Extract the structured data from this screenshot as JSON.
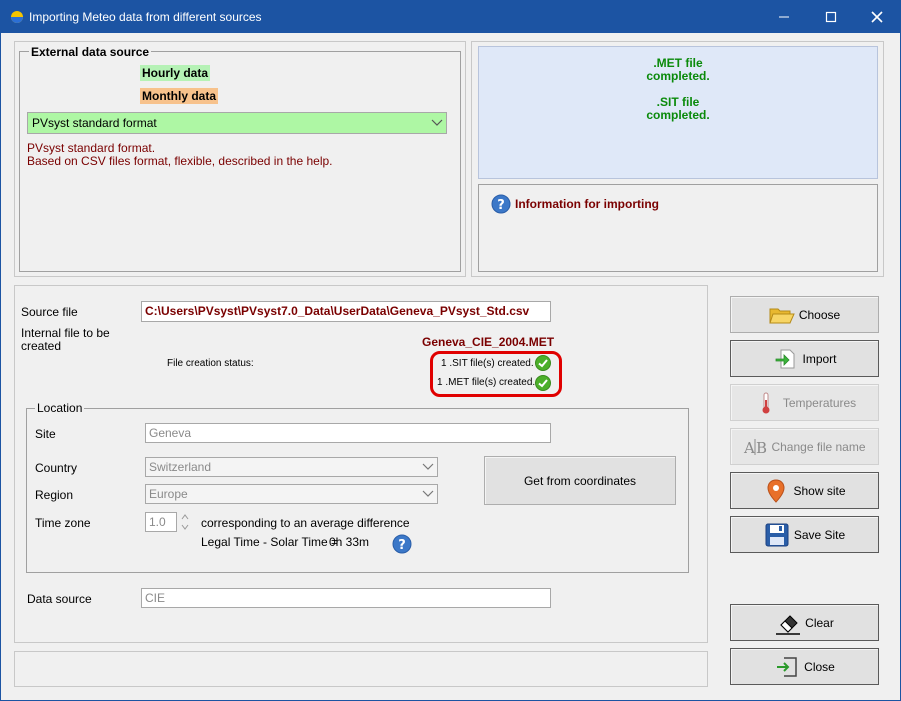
{
  "window": {
    "title": "Importing Meteo data from different sources"
  },
  "external_source": {
    "legend": "External data source",
    "hourly_label": "Hourly data",
    "monthly_label": "Monthly data",
    "format_selected": "PVsyst standard format",
    "description_line1": "PVsyst standard format.",
    "description_line2": "Based on CSV files format, flexible, described in the help."
  },
  "status_panel": {
    "met_line1": ".MET file",
    "met_line2": "completed.",
    "sit_line1": ".SIT file",
    "sit_line2": "completed."
  },
  "info_panel": {
    "title": "Information for importing"
  },
  "files": {
    "source_label": "Source file",
    "source_path": "C:\\Users\\PVsyst\\PVsyst7.0_Data\\UserData\\Geneva_PVsyst_Std.csv",
    "internal_label_1": "Internal file to be",
    "internal_label_2": "created",
    "internal_name": "Geneva_CIE_2004.MET",
    "status_label": "File creation status:",
    "sit_status": "1 .SIT file(s) created.",
    "met_status": "1 .MET file(s) created."
  },
  "location": {
    "legend": "Location",
    "site_label": "Site",
    "site_value": "Geneva",
    "country_label": "Country",
    "country_value": "Switzerland",
    "region_label": "Region",
    "region_value": "Europe",
    "timezone_label": "Time zone",
    "timezone_value": "1.0",
    "timezone_desc": "corresponding to an average difference",
    "legal_time_label": "Legal Time - Solar Time =",
    "legal_time_value": "0h 33m",
    "get_coords_label": "Get from coordinates"
  },
  "data_source": {
    "label": "Data source",
    "value": "CIE"
  },
  "buttons": {
    "choose": "Choose",
    "import": "Import",
    "temperatures": "Temperatures",
    "change_file_name": "Change file name",
    "show_site": "Show site",
    "save_site": "Save Site",
    "clear": "Clear",
    "close": "Close"
  },
  "colors": {
    "titlebar": "#1c54a3",
    "hourly_bg": "#b6f2b6",
    "monthly_bg": "#f7c28c",
    "format_bg": "#aef7a4",
    "status_panel_bg": "#dfe8f8",
    "status_text": "#0a8a0a",
    "dark_red": "#7a0000",
    "highlight_red": "#e00000"
  }
}
